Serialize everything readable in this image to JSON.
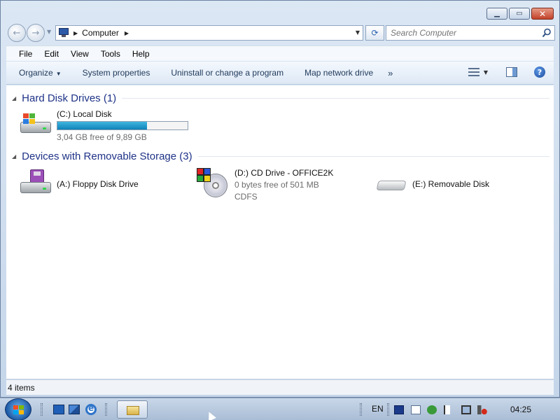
{
  "window": {
    "caption": {
      "minimize_glyph": "▁",
      "maximize_glyph": "▭",
      "close_glyph": "✕"
    }
  },
  "navigation": {
    "back_glyph": "←",
    "forward_glyph": "→",
    "address": {
      "location": "Computer",
      "icon": "computer-icon"
    },
    "refresh_glyph": "⟳",
    "search": {
      "placeholder": "Search Computer",
      "icon": "search-icon"
    }
  },
  "menubar": {
    "items": [
      "File",
      "Edit",
      "View",
      "Tools",
      "Help"
    ]
  },
  "commandbar": {
    "organize": "Organize",
    "system_properties": "System properties",
    "uninstall": "Uninstall or change a program",
    "map_drive": "Map network drive",
    "more": "»",
    "help_glyph": "?"
  },
  "groups": [
    {
      "title": "Hard Disk Drives (1)",
      "items": [
        {
          "name": "(C:) Local Disk",
          "detail": "3,04 GB free of 9,89 GB",
          "used_fraction": 0.69,
          "icon": "hard-disk-icon"
        }
      ]
    },
    {
      "title": "Devices with Removable Storage (3)",
      "items": [
        {
          "name": "(A:) Floppy Disk Drive",
          "icon": "floppy-drive-icon"
        },
        {
          "name": "(D:) CD Drive - OFFICE2K",
          "detail": "0 bytes free of 501 MB",
          "filesystem": "CDFS",
          "icon": "cd-drive-icon"
        },
        {
          "name": "(E:) Removable Disk",
          "icon": "removable-disk-icon"
        }
      ]
    }
  ],
  "statusbar": {
    "text": "4 items"
  },
  "taskbar": {
    "language": "EN",
    "clock": "04:25"
  },
  "colors": {
    "group_title": "#1e3287",
    "capacity_fill": "#0e82b8",
    "window_frame": "#c5d6ea"
  }
}
